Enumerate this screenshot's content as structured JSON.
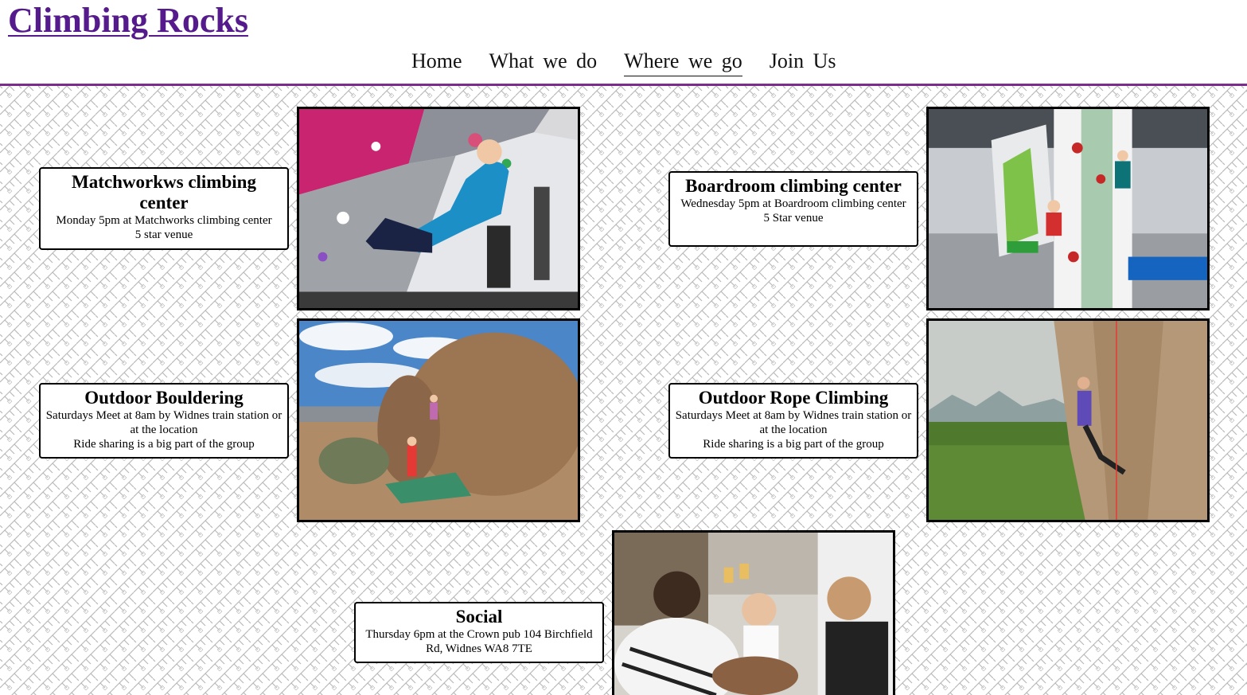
{
  "site": {
    "title": "Climbing Rocks"
  },
  "nav": {
    "items": [
      {
        "label": "Home"
      },
      {
        "label": "What we do"
      },
      {
        "label": "Where we go"
      },
      {
        "label": "Join Us"
      }
    ],
    "active": "Where we go"
  },
  "colors": {
    "accent": "#7b2d8e",
    "title_link": "#551a8b"
  },
  "locations": [
    {
      "title": "Matchworkws climbing center",
      "lines": [
        "Monday 5pm at Matchworks climbing center",
        "5 star venue"
      ]
    },
    {
      "title": "Boardroom climbing center",
      "lines": [
        "Wednesday 5pm at Boardroom climbing center",
        "5 Star venue"
      ]
    },
    {
      "title": "Outdoor Bouldering",
      "lines": [
        "Saturdays Meet at 8am by Widnes train station or at the location",
        "Ride sharing is a big part of the group"
      ]
    },
    {
      "title": "Outdoor Rope Climbing",
      "lines": [
        "Saturdays Meet at 8am by Widnes train station or at the location",
        "Ride sharing is a big part of the group"
      ]
    },
    {
      "title": "Social",
      "lines": [
        "Thursday 6pm at the Crown pub 104 Birchfield Rd, Widnes WA8 7TE"
      ]
    }
  ],
  "photos": [
    {
      "icon": "indoor-bouldering-photo"
    },
    {
      "icon": "indoor-climbing-wall-photo"
    },
    {
      "icon": "outdoor-boulder-photo"
    },
    {
      "icon": "rope-climbing-cliff-photo"
    },
    {
      "icon": "pub-social-photo"
    }
  ]
}
